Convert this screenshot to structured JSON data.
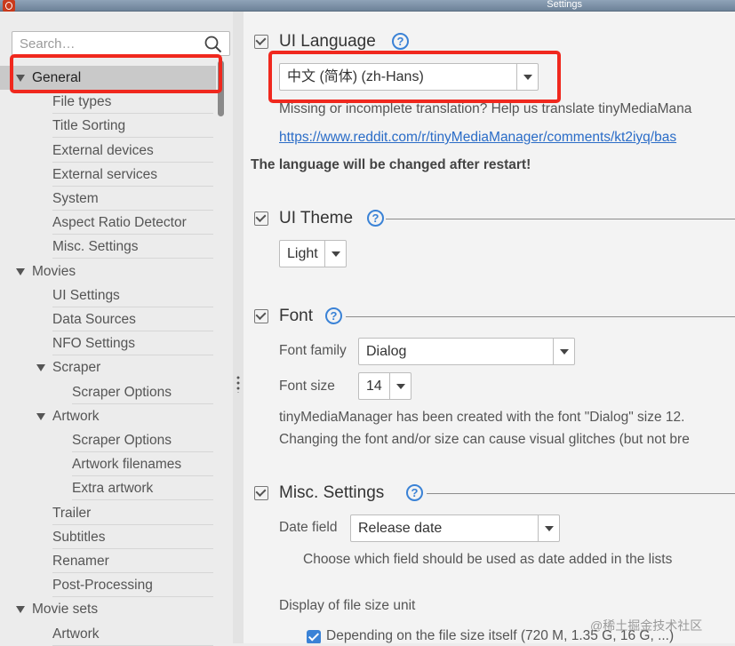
{
  "window": {
    "title": "Settings"
  },
  "search": {
    "placeholder": "Search…"
  },
  "tree": [
    {
      "label": "General",
      "level": 0,
      "expanded": true,
      "selected": true
    },
    {
      "label": "File types",
      "level": 1
    },
    {
      "label": "Title Sorting",
      "level": 1
    },
    {
      "label": "External devices",
      "level": 1
    },
    {
      "label": "External services",
      "level": 1
    },
    {
      "label": "System",
      "level": 1
    },
    {
      "label": "Aspect Ratio Detector",
      "level": 1
    },
    {
      "label": "Misc. Settings",
      "level": 1
    },
    {
      "label": "Movies",
      "level": 0,
      "expanded": true
    },
    {
      "label": "UI Settings",
      "level": 1
    },
    {
      "label": "Data Sources",
      "level": 1
    },
    {
      "label": "NFO Settings",
      "level": 1
    },
    {
      "label": "Scraper",
      "level": 1,
      "expanded": true
    },
    {
      "label": "Scraper Options",
      "level": 2
    },
    {
      "label": "Artwork",
      "level": 1,
      "expanded": true
    },
    {
      "label": "Scraper Options",
      "level": 2
    },
    {
      "label": "Artwork filenames",
      "level": 2
    },
    {
      "label": "Extra artwork",
      "level": 2
    },
    {
      "label": "Trailer",
      "level": 1
    },
    {
      "label": "Subtitles",
      "level": 1
    },
    {
      "label": "Renamer",
      "level": 1
    },
    {
      "label": "Post-Processing",
      "level": 1
    },
    {
      "label": "Movie sets",
      "level": 0,
      "expanded": true
    },
    {
      "label": "Artwork",
      "level": 1
    }
  ],
  "ui_language": {
    "title": "UI Language",
    "help": "?",
    "value": "中文 (简体) (zh-Hans)",
    "translate_text": "Missing or incomplete translation? Help us translate tinyMediaMana",
    "link": "https://www.reddit.com/r/tinyMediaManager/comments/kt2iyq/bas",
    "restart_note": "The language will be changed after restart!"
  },
  "ui_theme": {
    "title": "UI Theme",
    "help": "?",
    "value": "Light"
  },
  "font": {
    "title": "Font",
    "help": "?",
    "family_label": "Font family",
    "family_value": "Dialog",
    "size_label": "Font size",
    "size_value": "14",
    "info_line1": "tinyMediaManager has been created with the font \"Dialog\" size 12.",
    "info_line2": "Changing the font and/or size can cause visual glitches (but not bre"
  },
  "misc": {
    "title": "Misc. Settings",
    "help": "?",
    "date_label": "Date field",
    "date_value": "Release date",
    "date_desc": "Choose which field should be used as date added in the lists",
    "filesize_label": "Display of file size unit",
    "filesize_option": "Depending on the file size itself (720 M, 1.35 G, 16 G, ...)",
    "filesize_checked": true
  },
  "watermark": "@稀土掘金技术社区",
  "colors": {
    "highlight_box": "#f0281e",
    "accent": "#3a82d6",
    "link": "#2a6cc7",
    "selected_row": "#c9c9c9"
  }
}
